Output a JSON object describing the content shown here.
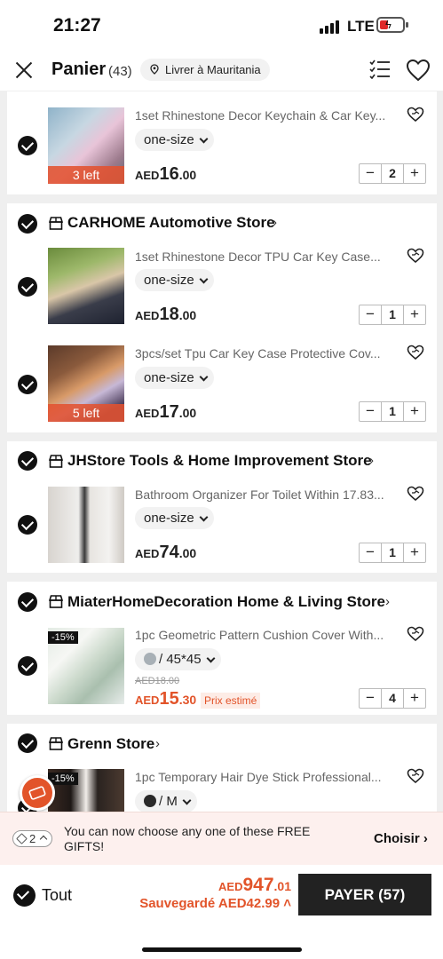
{
  "status_bar": {
    "time": "21:27",
    "network": "LTE"
  },
  "header": {
    "title": "Panier",
    "count": "(43)",
    "ship_to": "Livrer à Mauritania"
  },
  "stores": [
    {
      "name": "CARHOME Automotive Store"
    },
    {
      "name": "JHStore Tools & Home Improvement Store"
    },
    {
      "name": "MiaterHomeDecoration Home & Living Store"
    },
    {
      "name": "Grenn Store"
    }
  ],
  "items": [
    {
      "title": "1set Rhinestone Decor Keychain & Car Key...",
      "variant": "one-size",
      "currency": "AED",
      "price_int": "16",
      "price_dec": ".00",
      "qty": "2",
      "badge": "3 left"
    },
    {
      "title": "1set Rhinestone Decor TPU Car Key Case...",
      "variant": "one-size",
      "currency": "AED",
      "price_int": "18",
      "price_dec": ".00",
      "qty": "1"
    },
    {
      "title": "3pcs/set Tpu Car Key Case Protective Cov...",
      "variant": "one-size",
      "currency": "AED",
      "price_int": "17",
      "price_dec": ".00",
      "qty": "1",
      "badge": "5 left"
    },
    {
      "title": "Bathroom Organizer For Toilet Within 17.83...",
      "variant": "one-size",
      "currency": "AED",
      "price_int": "74",
      "price_dec": ".00",
      "qty": "1"
    },
    {
      "title": "1pc Geometric Pattern Cushion Cover With...",
      "variant": "/ 45*45",
      "currency": "AED",
      "price_int": "15",
      "price_dec": ".30",
      "orig_price": "AED18.00",
      "est": "Prix estimé",
      "qty": "4",
      "discount": "-15%",
      "swatch_color": "#a8b0b6"
    },
    {
      "title": "1pc Temporary Hair Dye Stick Professional...",
      "variant": "/ M",
      "discount": "-15%",
      "swatch_color": "#2a2a2a"
    }
  ],
  "gift_bar": {
    "count": "2",
    "text": "You can now choose any one of these FREE GIFTS!",
    "link": "Choisir"
  },
  "bottom": {
    "all_label": "Tout",
    "currency": "AED",
    "total_int": "947",
    "total_dec": ".01",
    "saved": "Sauvegardé AED42.99",
    "pay_label": "PAYER (57)"
  },
  "colors": {
    "accent": "#e2542a",
    "dark": "#222222",
    "badge_bg": "#e2542a"
  }
}
